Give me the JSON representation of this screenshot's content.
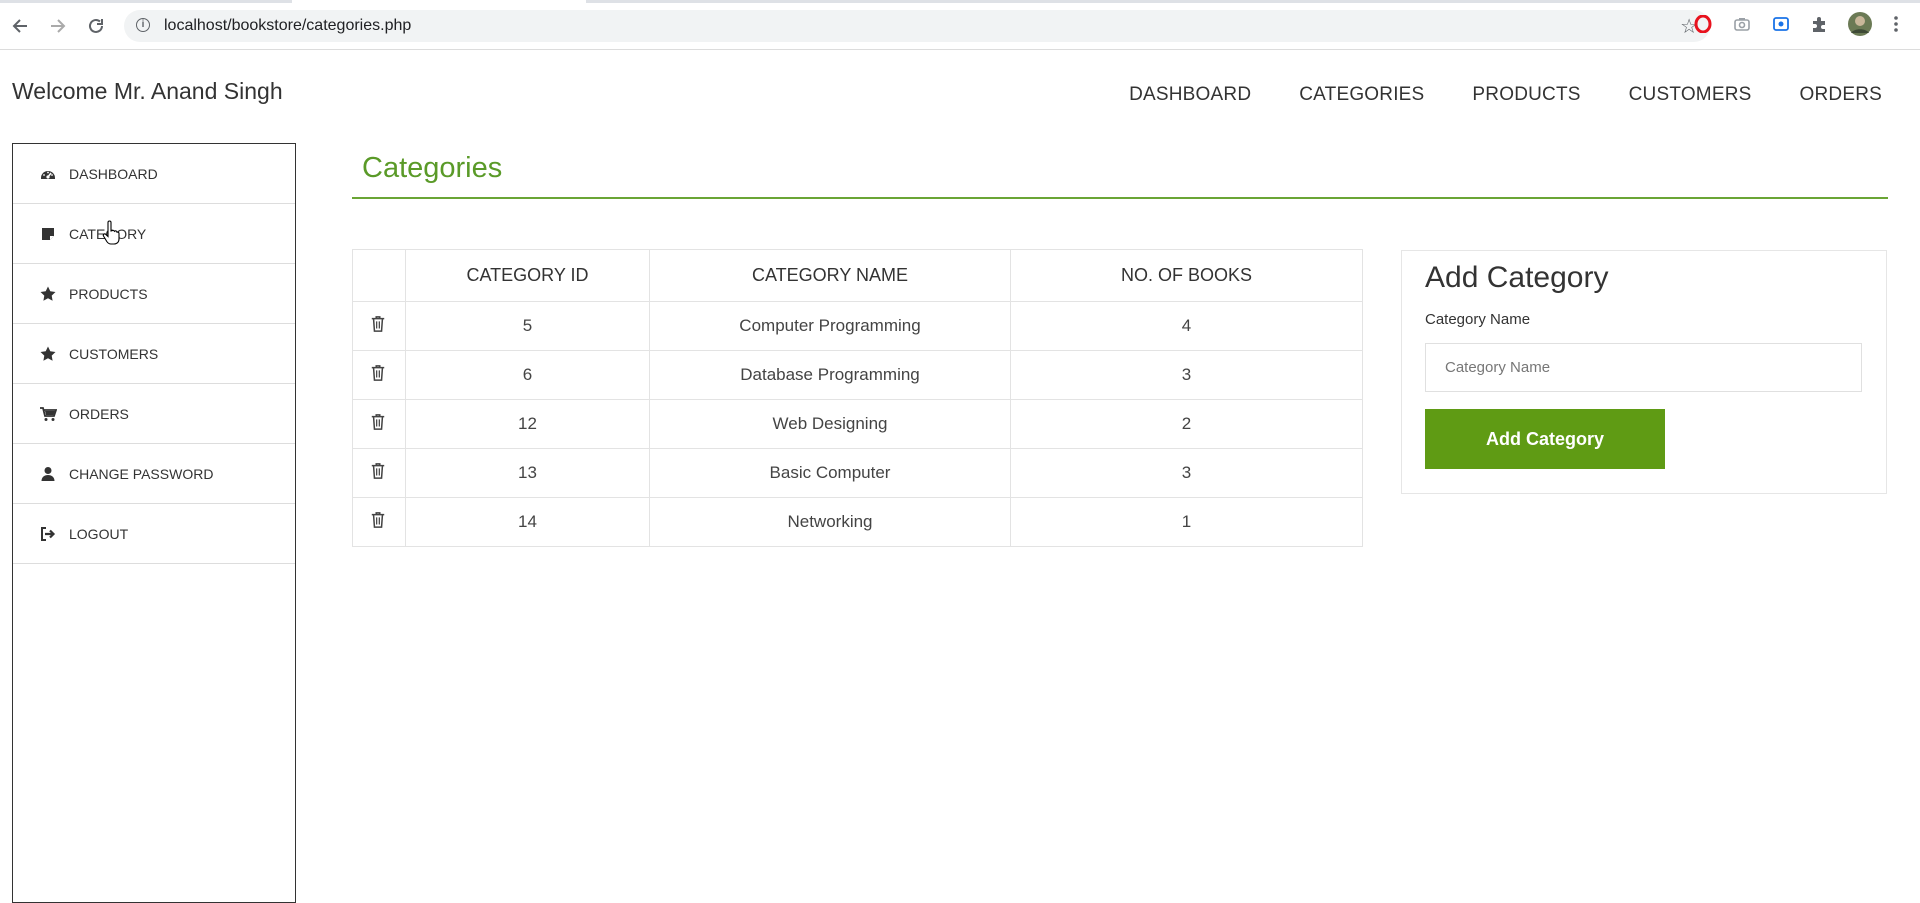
{
  "browser": {
    "url": "localhost/bookstore/categories.php",
    "back_icon": "arrow-left-icon",
    "forward_icon": "arrow-right-icon",
    "reload_icon": "reload-icon",
    "info_icon": "info-icon",
    "bookmark_icon": "star-icon",
    "extensions": [
      "opera-icon",
      "camera-icon",
      "screencast-icon",
      "puzzle-icon",
      "avatar-icon",
      "menu-dots-icon"
    ]
  },
  "header": {
    "welcome": "Welcome Mr. Anand Singh",
    "nav": [
      "DASHBOARD",
      "CATEGORIES",
      "PRODUCTS",
      "CUSTOMERS",
      "ORDERS"
    ]
  },
  "sidebar": {
    "items": [
      {
        "label": "DASHBOARD",
        "icon": "dashboard-icon"
      },
      {
        "label": "CATEGORY",
        "icon": "note-icon"
      },
      {
        "label": "PRODUCTS",
        "icon": "star-icon"
      },
      {
        "label": "CUSTOMERS",
        "icon": "star-icon"
      },
      {
        "label": "ORDERS",
        "icon": "cart-icon"
      },
      {
        "label": "CHANGE PASSWORD",
        "icon": "user-icon"
      },
      {
        "label": "LOGOUT",
        "icon": "logout-icon"
      }
    ]
  },
  "main": {
    "title": "Categories",
    "table": {
      "columns": [
        "",
        "CATEGORY ID",
        "CATEGORY NAME",
        "NO. OF BOOKS"
      ],
      "rows": [
        {
          "id": "5",
          "name": "Computer Programming",
          "books": "4"
        },
        {
          "id": "6",
          "name": "Database Programming",
          "books": "3"
        },
        {
          "id": "12",
          "name": "Web Designing",
          "books": "2"
        },
        {
          "id": "13",
          "name": "Basic Computer",
          "books": "3"
        },
        {
          "id": "14",
          "name": "Networking",
          "books": "1"
        }
      ]
    },
    "add_form": {
      "heading": "Add Category",
      "label": "Category Name",
      "placeholder": "Category Name",
      "value": "",
      "button": "Add Category"
    }
  },
  "colors": {
    "accent": "#5a9a28",
    "button": "#5f9b14",
    "rule": "#6aa535"
  }
}
